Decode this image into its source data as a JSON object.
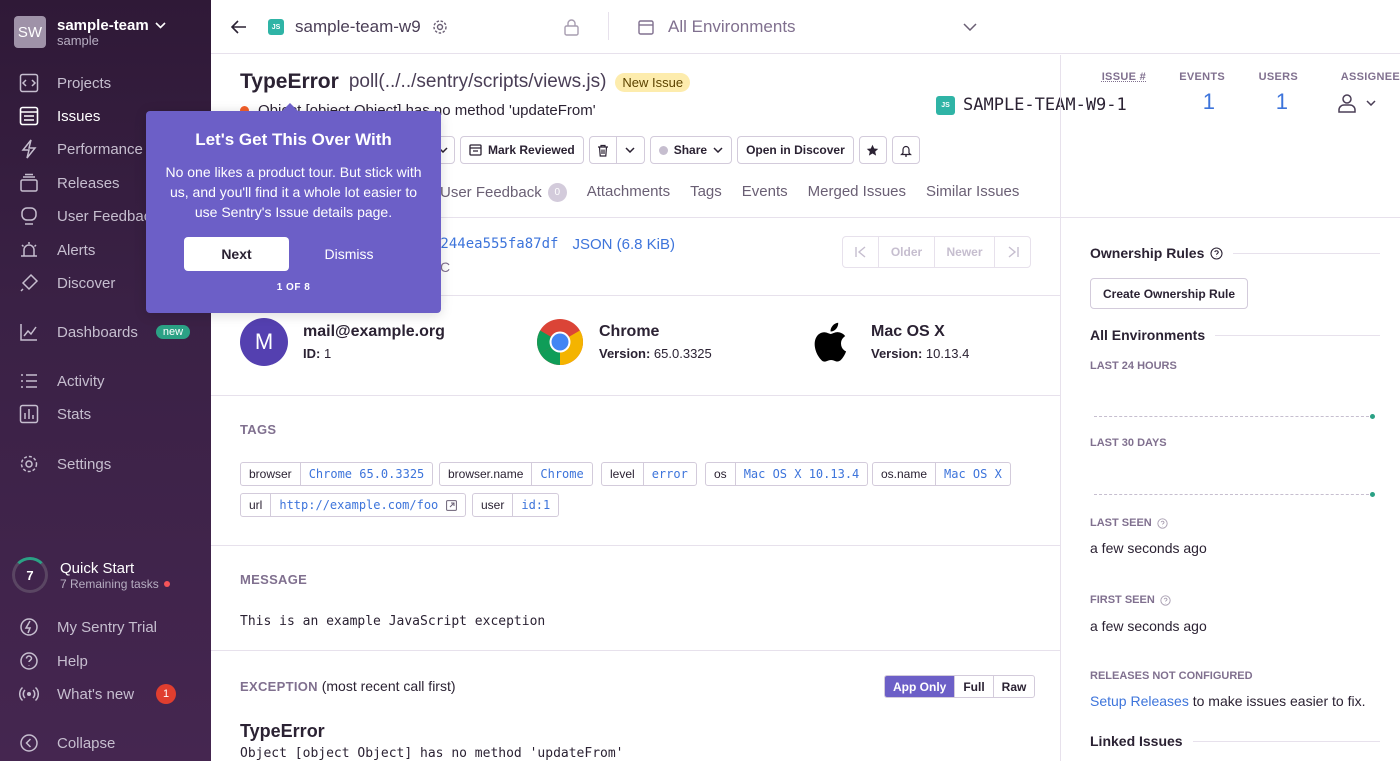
{
  "sidebar": {
    "org_initials": "SW",
    "org_name": "sample-team",
    "org_sub": "sample",
    "items": [
      {
        "label": "Projects",
        "icon": "projects-icon"
      },
      {
        "label": "Issues",
        "icon": "issues-icon"
      },
      {
        "label": "Performance",
        "icon": "performance-icon"
      },
      {
        "label": "Releases",
        "icon": "releases-icon"
      },
      {
        "label": "User Feedback",
        "icon": "user-feedback-icon"
      },
      {
        "label": "Alerts",
        "icon": "alerts-icon"
      },
      {
        "label": "Discover",
        "icon": "discover-icon"
      },
      {
        "label": "Dashboards",
        "icon": "dashboards-icon",
        "badge": "new"
      },
      {
        "label": "Activity",
        "icon": "activity-icon"
      },
      {
        "label": "Stats",
        "icon": "stats-icon"
      },
      {
        "label": "Settings",
        "icon": "settings-icon"
      }
    ],
    "quick_start": {
      "count": "7",
      "title": "Quick Start",
      "sub": "7 Remaining tasks"
    },
    "bottom": [
      {
        "label": "My Sentry Trial",
        "icon": "lightning-icon"
      },
      {
        "label": "Help",
        "icon": "help-icon"
      },
      {
        "label": "What's new",
        "icon": "broadcast-icon",
        "badge": "1"
      },
      {
        "label": "Collapse",
        "icon": "collapse-icon"
      }
    ]
  },
  "topbar": {
    "project": "sample-team-w9",
    "environment": "All Environments"
  },
  "issue": {
    "type": "TypeError",
    "culprit": "poll(../../sentry/scripts/views.js)",
    "status_badge": "New Issue",
    "message": "Object [object Object] has no method 'updateFrom'",
    "short_id_label": "ISSUE #",
    "short_id": "SAMPLE-TEAM-W9-1",
    "events_label": "EVENTS",
    "events": "1",
    "users_label": "USERS",
    "users": "1",
    "assignee_label": "ASSIGNEE"
  },
  "actions": {
    "mark_reviewed": "Mark Reviewed",
    "share": "Share",
    "open_discover": "Open in Discover"
  },
  "tabs": [
    {
      "label": "User Feedback",
      "count": "0"
    },
    {
      "label": "Attachments"
    },
    {
      "label": "Tags"
    },
    {
      "label": "Events"
    },
    {
      "label": "Merged Issues"
    },
    {
      "label": "Similar Issues"
    }
  ],
  "event": {
    "id_fragment": "b244ea555fa87df",
    "json_link": "JSON (6.8 KiB)",
    "date_fragment": "C",
    "pager": {
      "older": "Older",
      "newer": "Newer"
    }
  },
  "contexts": {
    "user": {
      "initial": "M",
      "title": "mail@example.org",
      "label": "ID:",
      "value": "1"
    },
    "browser": {
      "title": "Chrome",
      "label": "Version:",
      "value": "65.0.3325"
    },
    "os": {
      "title": "Mac OS X",
      "label": "Version:",
      "value": "10.13.4"
    }
  },
  "tags_section": {
    "label": "TAGS",
    "tags": [
      {
        "key": "browser",
        "value": "Chrome 65.0.3325"
      },
      {
        "key": "browser.name",
        "value": "Chrome"
      },
      {
        "key": "level",
        "value": "error"
      },
      {
        "key": "os",
        "value": "Mac OS X 10.13.4"
      },
      {
        "key": "os.name",
        "value": "Mac OS X"
      },
      {
        "key": "url",
        "value": "http://example.com/foo"
      },
      {
        "key": "user",
        "value": "id:1"
      }
    ]
  },
  "message_section": {
    "label": "MESSAGE",
    "text": "This is an example JavaScript exception"
  },
  "exception_section": {
    "label": "EXCEPTION",
    "hint": "(most recent call first)",
    "seg": [
      "App Only",
      "Full",
      "Raw"
    ],
    "type": "TypeError",
    "value": "Object [object Object] has no method 'updateFrom'"
  },
  "right": {
    "ownership": "Ownership Rules",
    "create_rule": "Create Ownership Rule",
    "all_env": "All Environments",
    "last24": "LAST 24 HOURS",
    "last30": "LAST 30 DAYS",
    "last_seen_label": "LAST SEEN",
    "last_seen": "a few seconds ago",
    "first_seen_label": "FIRST SEEN",
    "first_seen": "a few seconds ago",
    "releases_label": "RELEASES NOT CONFIGURED",
    "setup_link": "Setup Releases",
    "setup_rest": " to make issues easier to fix.",
    "linked": "Linked Issues"
  },
  "tour": {
    "title": "Let's Get This Over With",
    "body": "No one likes a product tour. But stick with us, and you'll find it a whole lot easier to use Sentry's Issue details page.",
    "next": "Next",
    "dismiss": "Dismiss",
    "step": "1 OF 8"
  },
  "colors": {
    "accent": "#6c5fc7",
    "link": "#3d74db",
    "error": "#f35f2a"
  }
}
